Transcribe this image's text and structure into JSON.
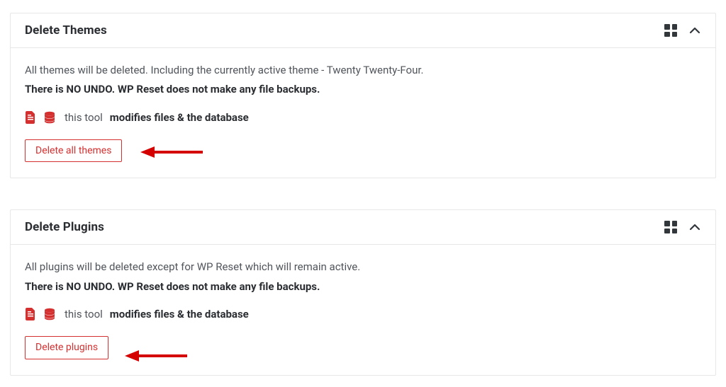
{
  "cards": [
    {
      "id": "delete-themes",
      "title": "Delete Themes",
      "description": "All themes will be deleted. Including the currently active theme - Twenty Twenty-Four.",
      "warning": "There is NO UNDO. WP Reset does not make any file backups.",
      "modifies_prefix": "this tool",
      "modifies_strong": "modifies files & the database",
      "button_label": "Delete all themes"
    },
    {
      "id": "delete-plugins",
      "title": "Delete Plugins",
      "description": "All plugins will be deleted except for WP Reset which will remain active.",
      "warning": "There is NO UNDO. WP Reset does not make any file backups.",
      "modifies_prefix": "this tool",
      "modifies_strong": "modifies files & the database",
      "button_label": "Delete plugins"
    }
  ],
  "colors": {
    "danger": "#d53030",
    "border": "#e7e7e8"
  }
}
